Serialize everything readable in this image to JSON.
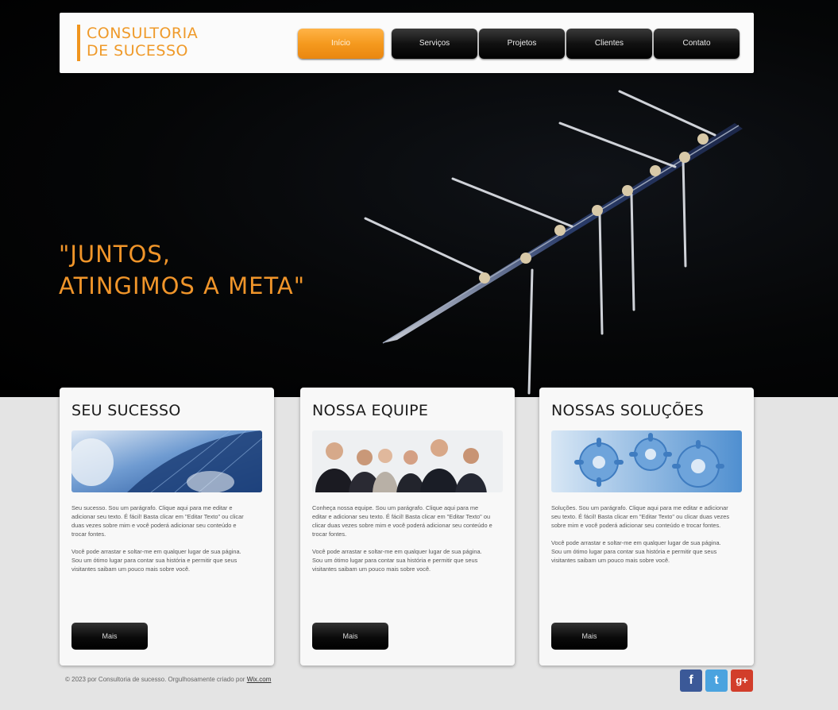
{
  "header": {
    "logo_line1": "CONSULTORIA",
    "logo_line2": "DE SUCESSO",
    "nav": [
      "Início",
      "Serviços",
      "Projetos",
      "Clientes",
      "Contato"
    ]
  },
  "hero": {
    "tagline_line1": "\"JUNTOS,",
    "tagline_line2": "ATINGIMOS A META\""
  },
  "cards": [
    {
      "title": "SEU SUCESSO",
      "p1": "Seu sucesso. Sou um parágrafo. Clique aqui para me editar e adicionar seu texto. É fácil! Basta clicar em \"Editar Texto\" ou clicar duas vezes sobre mim e você poderá adicionar seu conteúdo e trocar fontes.",
      "p2": "Você pode arrastar e soltar-me em qualquer lugar de sua página. Sou um ótimo lugar para contar sua história e permitir que seus visitantes saibam um pouco mais sobre você.",
      "button": "Mais"
    },
    {
      "title": "NOSSA EQUIPE",
      "p1": "Conheça nossa equipe. Sou um parágrafo. Clique aqui para me editar e adicionar seu texto. É fácil! Basta clicar em \"Editar Texto\" ou clicar duas vezes sobre mim e você poderá adicionar seu conteúdo e trocar fontes.",
      "p2": "Você pode arrastar e soltar-me em qualquer lugar de sua página. Sou um ótimo lugar para contar sua história e permitir que seus visitantes saibam um pouco mais sobre você.",
      "button": "Mais"
    },
    {
      "title": "NOSSAS SOLUÇÕES",
      "p1": "Soluções. Sou um parágrafo. Clique aqui para me editar e adicionar seu texto. É fácil! Basta clicar em \"Editar Texto\" ou clicar duas vezes sobre mim e você poderá adicionar seu conteúdo e trocar fontes.",
      "p2": "Você pode arrastar e soltar-me em qualquer lugar de sua página. Sou um ótimo lugar para contar sua história e permitir que seus visitantes saibam um pouco mais sobre você.",
      "button": "Mais"
    }
  ],
  "footer": {
    "text": "© 2023 por Consultoria de sucesso. Orgulhosamente criado por",
    "link": "Wix.com"
  },
  "colors": {
    "accent": "#f0951e",
    "facebook": "#3b5998",
    "twitter": "#4aa3df",
    "googleplus": "#d23e2b"
  },
  "social": [
    "facebook-icon",
    "twitter-icon",
    "googleplus-icon"
  ]
}
